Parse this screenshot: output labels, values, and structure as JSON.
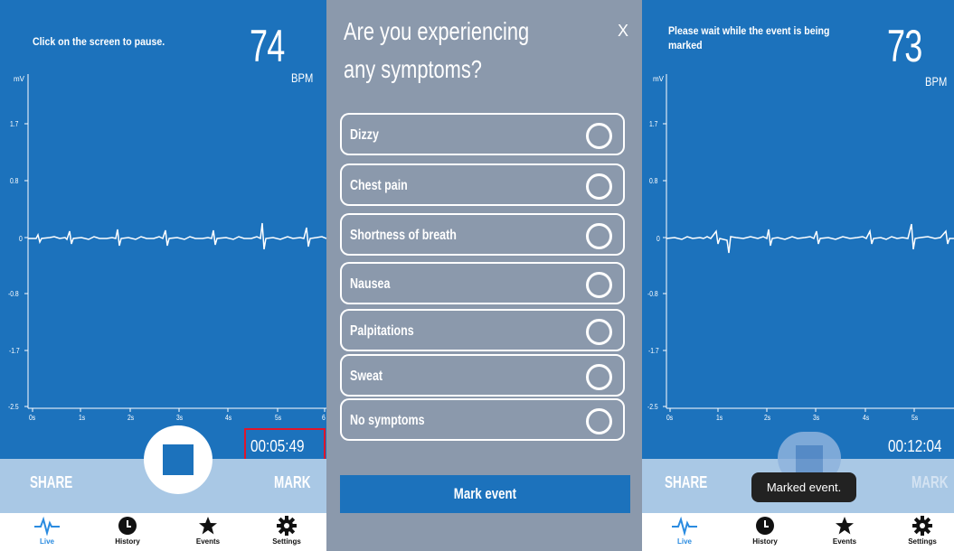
{
  "screen_live": {
    "hint": "Click on the screen to pause.",
    "bpm_value": "74",
    "bpm_label": "BPM",
    "unit_label": "mV",
    "y_ticks": [
      "1.7",
      "0.8",
      "0",
      "-0.8",
      "-1.7",
      "-2.5"
    ],
    "x_ticks": [
      "0s",
      "1s",
      "2s",
      "3s",
      "4s",
      "5s",
      "6"
    ],
    "timer": "00:05:49",
    "share": "SHARE",
    "mark": "MARK"
  },
  "symptoms_dialog": {
    "question": "Are you experiencing any symptoms?",
    "close": "X",
    "options": [
      "Dizzy",
      "Chest pain",
      "Shortness of breath",
      "Nausea",
      "Palpitations",
      "Sweat",
      "No symptoms"
    ],
    "submit": "Mark event"
  },
  "screen_marking": {
    "hint": "Please wait while the event is being marked",
    "bpm_value": "73",
    "bpm_label": "BPM",
    "unit_label": "mV",
    "y_ticks": [
      "1.7",
      "0.8",
      "0",
      "-0.8",
      "-1.7",
      "-2.5"
    ],
    "x_ticks": [
      "0s",
      "1s",
      "2s",
      "3s",
      "4s",
      "5s"
    ],
    "timer": "00:12:04",
    "share": "SHARE",
    "mark": "MARK",
    "toast": "Marked event."
  },
  "tabs": [
    {
      "label": "Live",
      "icon": "heartbeat-icon"
    },
    {
      "label": "History",
      "icon": "clock-icon"
    },
    {
      "label": "Events",
      "icon": "star-icon"
    },
    {
      "label": "Settings",
      "icon": "gear-icon"
    }
  ],
  "colors": {
    "screen_blue": "#1c72bc",
    "bar_blue": "#a9c8e5",
    "dialog_grey": "#8b99ac",
    "highlight_red": "#e0162b",
    "active_tab": "#2a8be0"
  }
}
